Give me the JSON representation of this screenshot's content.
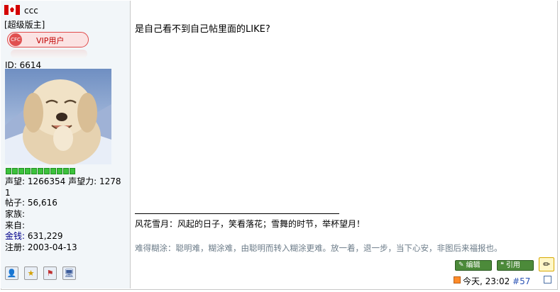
{
  "user": {
    "name": "ccc",
    "rank": "[超级版主]",
    "badge_logo": "CFC",
    "badge_label": "VIP用户",
    "id_line": "ID: 6614",
    "level_segments": 11,
    "stats": {
      "line1": "声望: 1266354 声望力: 1278",
      "line2": "1",
      "posts": "帖子: 56,616",
      "family": "家族:",
      "from": "来自:",
      "money_label": "金钱:",
      "money_value": " 631,229",
      "registered": "注册: 2003-04-13"
    },
    "actions": [
      {
        "icon": "user-icon",
        "glyph": "👤"
      },
      {
        "icon": "star-icon",
        "glyph": "★"
      },
      {
        "icon": "flag-icon",
        "glyph": "⚑"
      },
      {
        "icon": "computer-icon",
        "glyph": "🖥"
      }
    ]
  },
  "post": {
    "title": "是自己看不到自己帖里面的LIKE?",
    "signature_line1": "风花雪月：风起的日子，笑看落花；雪舞的时节，举杯望月！",
    "signature_line2": "难得糊涂：聪明难，糊涂难，由聪明而转入糊涂更难。放一着，退一步，当下心安，非图后来福报也。",
    "edit_label": "编辑",
    "quote_label": "引用",
    "time": "今天, 23:02 ",
    "post_number": "#57"
  },
  "colors": {
    "sidebar_bg": "#f2f6f9",
    "border": "#c8c8c8",
    "level_green": "#3cc23c",
    "button_green": "#4c8a3a",
    "link_blue": "#2b53b5"
  }
}
